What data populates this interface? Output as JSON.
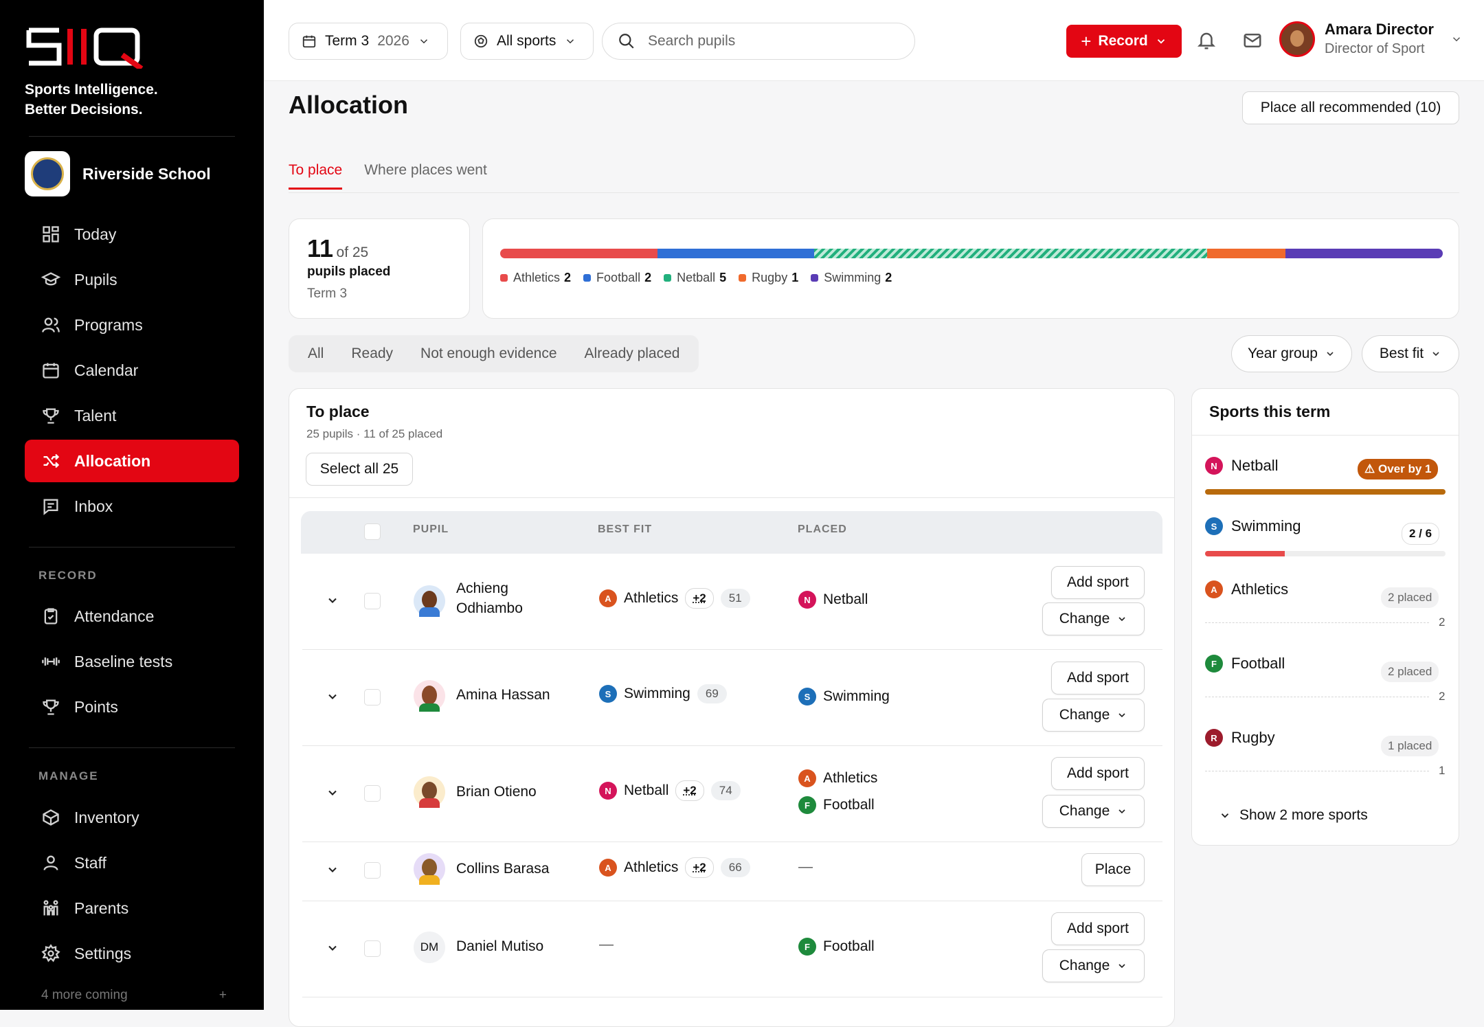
{
  "brand": {
    "logo_text": "SIIQ",
    "tagline_1": "Sports Intelligence.",
    "tagline_2": "Better Decisions."
  },
  "school": {
    "name": "Riverside School"
  },
  "nav": {
    "main": [
      "Today",
      "Pupils",
      "Programs",
      "Calendar",
      "Talent",
      "Allocation",
      "Inbox"
    ],
    "record_title": "RECORD",
    "record": [
      "Attendance",
      "Baseline tests",
      "Points"
    ],
    "manage_title": "MANAGE",
    "manage": [
      "Inventory",
      "Staff",
      "Parents",
      "Settings"
    ],
    "more": "4 more coming",
    "more_plus": "+"
  },
  "topbar": {
    "term_label": "Term 3",
    "term_year": "2026",
    "sports": "All sports",
    "search_placeholder": "Search pupils",
    "record": "Record",
    "user_name": "Amara Director",
    "user_role": "Director of Sport"
  },
  "page": {
    "title": "Allocation",
    "place_all": "Place all recommended (10)",
    "tabs": [
      "To place",
      "Where places went"
    ]
  },
  "summary": {
    "placed": "11",
    "of": "of 25",
    "label": "pupils placed",
    "term": "Term 3"
  },
  "distribution": [
    {
      "sport": "Athletics",
      "count": 2,
      "color": "#e84b4b"
    },
    {
      "sport": "Football",
      "count": 2,
      "color": "#2f6fd6"
    },
    {
      "sport": "Netball",
      "count": 5,
      "color": "#22b07d"
    },
    {
      "sport": "Rugby",
      "count": 1,
      "color": "#f06a2c"
    },
    {
      "sport": "Swimming",
      "count": 2,
      "color": "#5a3cb5"
    }
  ],
  "filters": [
    "All",
    "Ready",
    "Not enough evidence",
    "Already placed"
  ],
  "sorts": {
    "year_group": "Year group",
    "best_fit": "Best fit"
  },
  "to_place": {
    "title": "To place",
    "subtitle": "25 pupils · 11 of 25 placed",
    "select_all": "Select all 25",
    "headers": {
      "pupil": "PUPIL",
      "best_fit": "BEST FIT",
      "placed": "PLACED"
    },
    "rows": [
      {
        "name_1": "Achieng",
        "name_2": "Odhiambo",
        "best": "Athletics",
        "extra": "+2",
        "score": "51",
        "placed": [
          "Netball"
        ],
        "actions": [
          "Add sport",
          "Change"
        ]
      },
      {
        "name_1": "Amina Hassan",
        "name_2": "",
        "best": "Swimming",
        "extra": "",
        "score": "69",
        "placed": [
          "Swimming"
        ],
        "actions": [
          "Add sport",
          "Change"
        ]
      },
      {
        "name_1": "Brian Otieno",
        "name_2": "",
        "best": "Netball",
        "extra": "+2",
        "score": "74",
        "placed": [
          "Athletics",
          "Football"
        ],
        "actions": [
          "Add sport",
          "Change"
        ]
      },
      {
        "name_1": "Collins Barasa",
        "name_2": "",
        "best": "Athletics",
        "extra": "+2",
        "score": "66",
        "placed_empty": "—",
        "actions": [
          "Place"
        ]
      },
      {
        "name_1": "Daniel Mutiso",
        "name_2": "",
        "initials": "DM",
        "best_empty": "—",
        "placed": [
          "Football"
        ],
        "actions": [
          "Add sport",
          "Change"
        ]
      }
    ]
  },
  "sports_term": {
    "title": "Sports this term",
    "netball": {
      "name": "Netball",
      "badge": "Over by 1"
    },
    "swimming": {
      "name": "Swimming",
      "badge": "2 / 6",
      "fill": 0.33
    },
    "athletics": {
      "name": "Athletics",
      "badge": "2 placed",
      "cap": "2"
    },
    "football": {
      "name": "Football",
      "badge": "2 placed",
      "cap": "2"
    },
    "rugby": {
      "name": "Rugby",
      "badge": "1 placed",
      "cap": "1"
    },
    "show_more": "Show 2 more sports"
  }
}
